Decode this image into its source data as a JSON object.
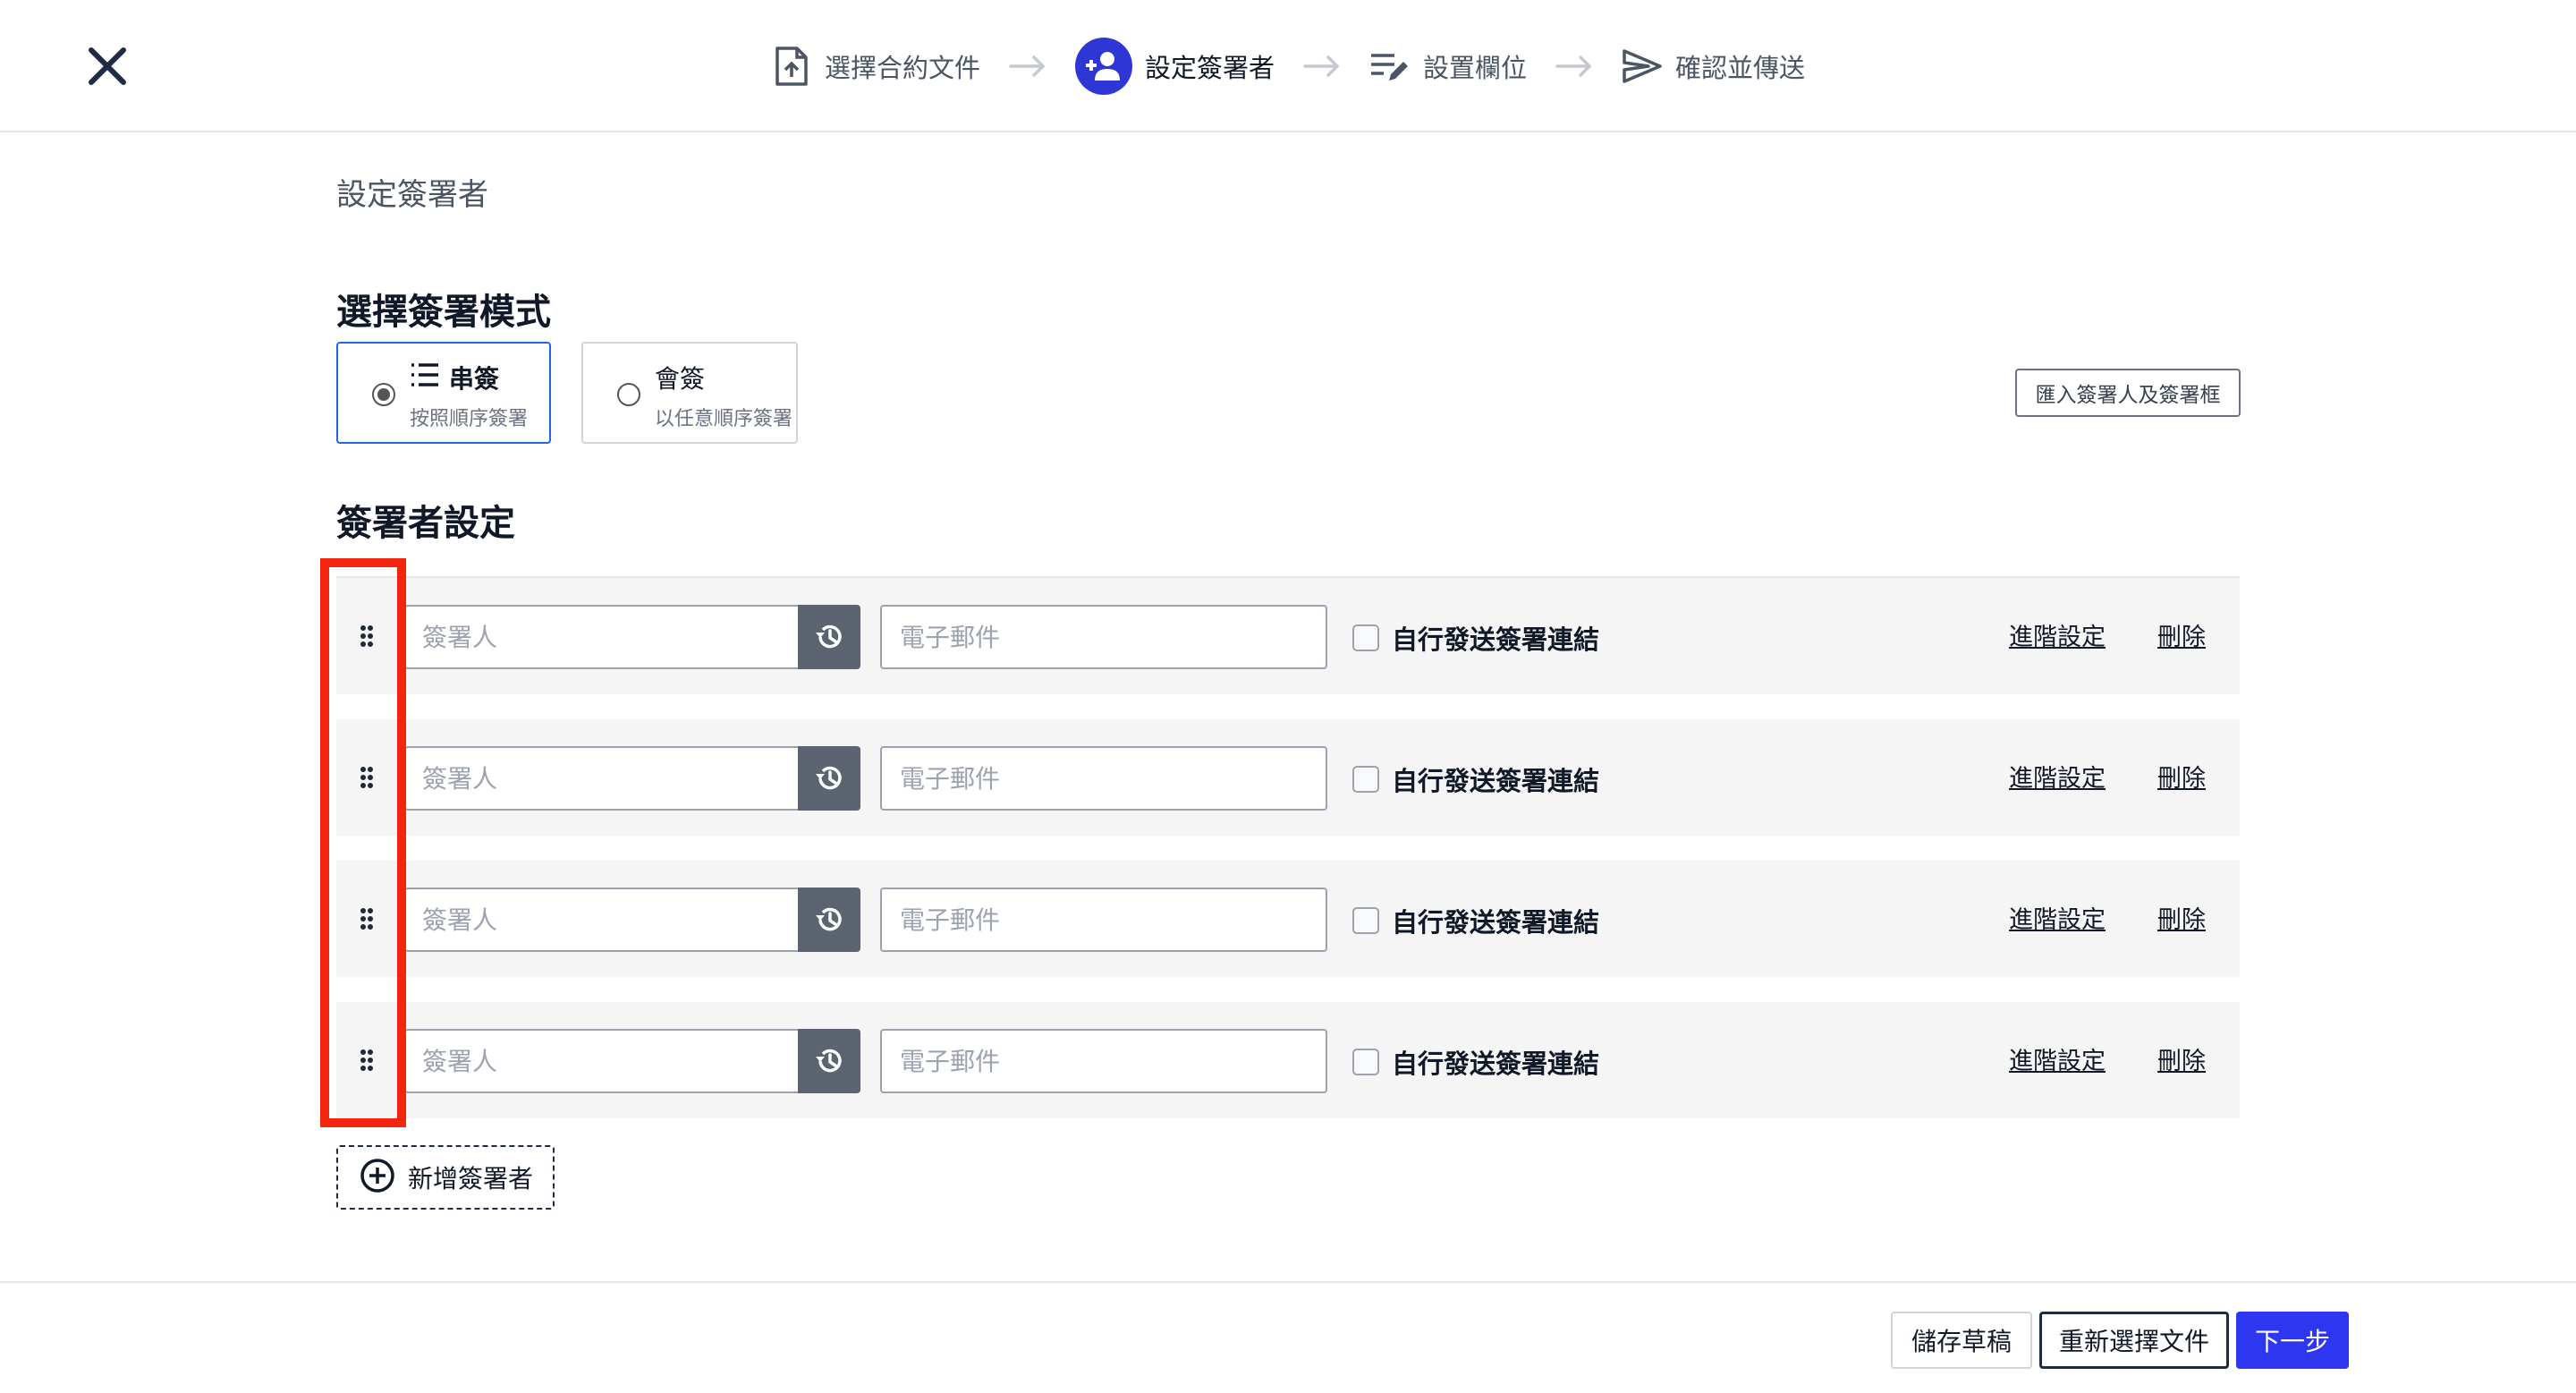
{
  "header": {
    "steps": [
      {
        "label": "選擇合約文件",
        "icon": "upload-file-icon"
      },
      {
        "label": "設定簽署者",
        "icon": "add-person-icon",
        "active": true
      },
      {
        "label": "設置欄位",
        "icon": "edit-list-icon"
      },
      {
        "label": "確認並傳送",
        "icon": "send-icon"
      }
    ],
    "accent_color": "#2f36d6"
  },
  "page": {
    "breadcrumb": "設定簽署者",
    "mode_section_title": "選擇簽署模式",
    "modes": [
      {
        "label": "串簽",
        "description": "按照順序簽署",
        "selected": true
      },
      {
        "label": "會簽",
        "description": "以任意順序簽署",
        "selected": false
      }
    ],
    "import_button": "匯入簽署人及簽署框",
    "signers_section_title": "簽署者設定",
    "signers": [
      {
        "name_placeholder": "簽署人",
        "email_placeholder": "電子郵件",
        "self_send_label": "自行發送簽署連結",
        "advanced_label": "進階設定",
        "delete_label": "刪除"
      },
      {
        "name_placeholder": "簽署人",
        "email_placeholder": "電子郵件",
        "self_send_label": "自行發送簽署連結",
        "advanced_label": "進階設定",
        "delete_label": "刪除"
      },
      {
        "name_placeholder": "簽署人",
        "email_placeholder": "電子郵件",
        "self_send_label": "自行發送簽署連結",
        "advanced_label": "進階設定",
        "delete_label": "刪除"
      },
      {
        "name_placeholder": "簽署人",
        "email_placeholder": "電子郵件",
        "self_send_label": "自行發送簽署連結",
        "advanced_label": "進階設定",
        "delete_label": "刪除"
      }
    ],
    "add_signer_label": "新增簽署者"
  },
  "footer": {
    "save_draft": "儲存草稿",
    "reselect_document": "重新選擇文件",
    "next": "下一步",
    "next_color": "#2f36f0"
  }
}
